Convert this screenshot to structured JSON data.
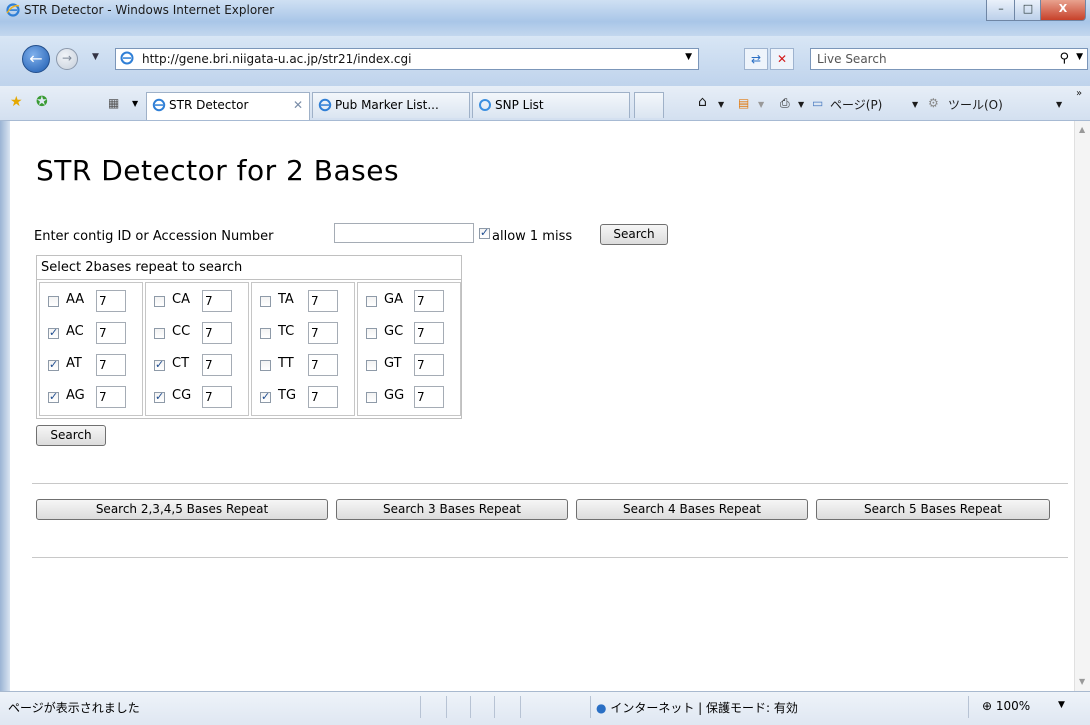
{
  "window": {
    "title": "STR Detector - Windows Internet Explorer",
    "controls": [
      "–",
      "□",
      "X"
    ]
  },
  "address_bar": {
    "url": "http://gene.bri.niigata-u.ac.jp/str21/index.cgi",
    "search_placeholder": "Live Search"
  },
  "tabs": [
    {
      "label": "STR Detector",
      "active": true
    },
    {
      "label": "Pub Marker List...",
      "active": false
    },
    {
      "label": "SNP List",
      "active": false
    }
  ],
  "commands": {
    "page": "ページ(P)",
    "tools": "ツール(O)"
  },
  "page": {
    "heading": "STR Detector for 2 Bases",
    "accession_label": "Enter contig ID or Accession Number",
    "accession_value": "",
    "allow_miss_label": "allow 1 miss",
    "allow_miss_checked": true,
    "search_label": "Search",
    "select_header": "Select 2bases repeat to search",
    "repeat_columns": [
      [
        {
          "code": "AA",
          "value": "7",
          "checked": false
        },
        {
          "code": "AC",
          "value": "7",
          "checked": true
        },
        {
          "code": "AT",
          "value": "7",
          "checked": true
        },
        {
          "code": "AG",
          "value": "7",
          "checked": true
        }
      ],
      [
        {
          "code": "CA",
          "value": "7",
          "checked": false
        },
        {
          "code": "CC",
          "value": "7",
          "checked": false
        },
        {
          "code": "CT",
          "value": "7",
          "checked": true
        },
        {
          "code": "CG",
          "value": "7",
          "checked": true
        }
      ],
      [
        {
          "code": "TA",
          "value": "7",
          "checked": false
        },
        {
          "code": "TC",
          "value": "7",
          "checked": false
        },
        {
          "code": "TT",
          "value": "7",
          "checked": false
        },
        {
          "code": "TG",
          "value": "7",
          "checked": true
        }
      ],
      [
        {
          "code": "GA",
          "value": "7",
          "checked": false
        },
        {
          "code": "GC",
          "value": "7",
          "checked": false
        },
        {
          "code": "GT",
          "value": "7",
          "checked": false
        },
        {
          "code": "GG",
          "value": "7",
          "checked": false
        }
      ]
    ],
    "search2_label": "Search",
    "repeat_buttons": [
      "Search 2,3,4,5 Bases Repeat",
      "Search 3 Bases Repeat",
      "Search 4 Bases Repeat",
      "Search 5 Bases Repeat"
    ]
  },
  "status_bar": {
    "status": "ページが表示されました",
    "zone": "インターネット | 保護モード: 有効",
    "zoom": "100%"
  }
}
